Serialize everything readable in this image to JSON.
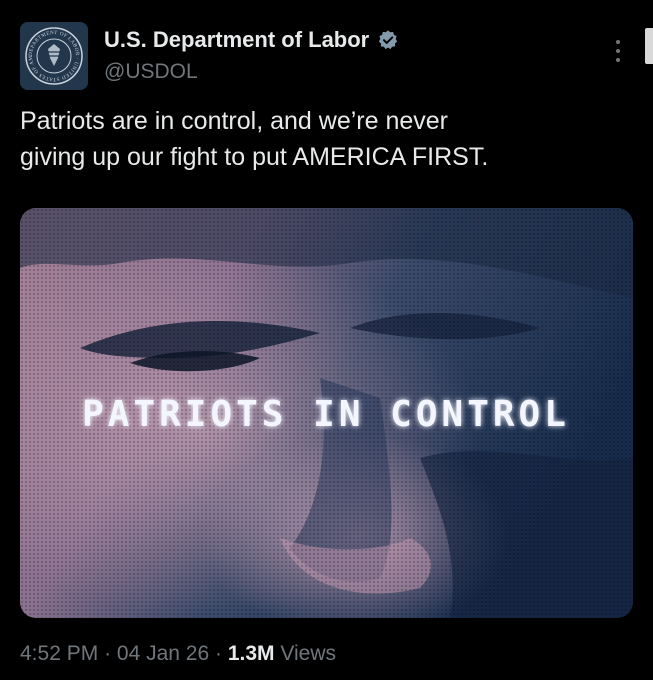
{
  "account": {
    "display_name": "U.S. Department of Labor",
    "handle": "@USDOL",
    "verified_icon": "verified-badge-icon",
    "avatar_seal_text": "DEPARTMENT OF LABOR · UNITED STATES OF AMERICA"
  },
  "tweet": {
    "text": "Patriots are in control, and we’re never\ngiving up our fight to put AMERICA FIRST."
  },
  "media": {
    "overlay_text": "PATRIOTS IN CONTROL"
  },
  "meta": {
    "time": "4:52 PM",
    "separator": "·",
    "date": "04 Jan 26",
    "views_count": "1.3M",
    "views_label": "Views"
  },
  "colors": {
    "background": "#000000",
    "text_primary": "#e7e9ea",
    "text_secondary": "#71767b",
    "verified_badge": "#829aab",
    "media_tint_warm": "#b58aa0",
    "media_tint_cool": "#1c3354"
  },
  "icons": [
    "verified-badge-icon",
    "more-options-icon"
  ]
}
